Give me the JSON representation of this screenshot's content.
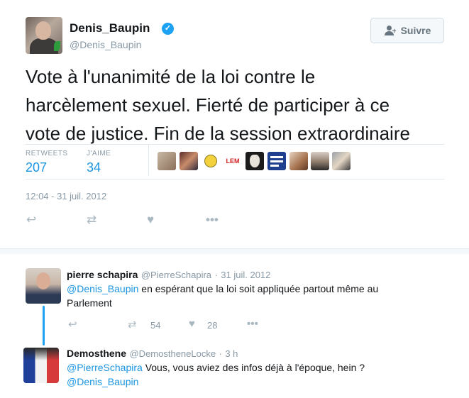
{
  "tweet": {
    "author_name": "Denis_Baupin",
    "author_handle": "@Denis_Baupin",
    "verified_icon": "verified-badge-icon",
    "follow_label": "Suivre",
    "text_lines": [
      "Vote à l'unanimité de la loi contre le",
      "harcèlement sexuel. Fierté de participer à ce",
      "vote de justice. Fin de la session extraordinaire"
    ],
    "retweets_label": "RETWEETS",
    "retweets_value": "207",
    "likes_label": "J'AIME",
    "likes_value": "34",
    "fav_avatar_lemag_text": "LEM",
    "timestamp": "12:04 - 31 juil. 2012"
  },
  "icons": [
    "reply-icon",
    "retweet-icon",
    "like-icon",
    "more-icon"
  ],
  "colors": {
    "link": "#1b95e0",
    "verified": "#1da1f2",
    "muted": "#8899a6"
  },
  "replies": [
    {
      "name": "pierre schapira",
      "handle": "@PierreSchapira",
      "sep": "·",
      "date": "31 juil. 2012",
      "mention": "@Denis_Baupin",
      "text_line1": " en espérant que la loi soit appliquée  partout même au",
      "text_line2": "Parlement",
      "retweet_count": "54",
      "like_count": "28"
    },
    {
      "name": "Demosthene",
      "handle": "@DemostheneLocke",
      "sep": "·",
      "date": "3 h",
      "mention1": "@PierreSchapira",
      "text_line1": " Vous, vous aviez des infos déjà à l'époque, hein ?",
      "mention2": "@Denis_Baupin"
    }
  ]
}
